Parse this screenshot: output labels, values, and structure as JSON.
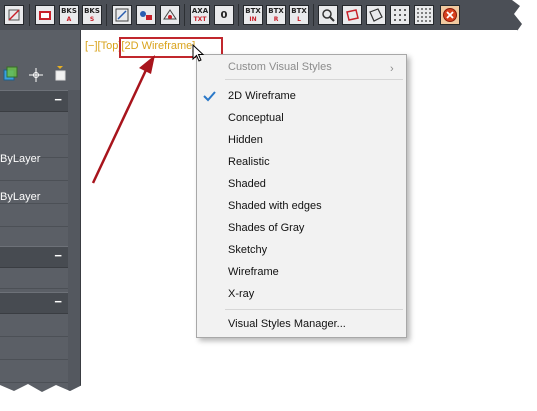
{
  "toolbar": {
    "buttons": [
      {
        "name": "tool-1",
        "label": "",
        "sub": ""
      },
      {
        "name": "tool-2",
        "label": "",
        "sub": ""
      },
      {
        "name": "bks-a",
        "label": "BKS",
        "sub": "A"
      },
      {
        "name": "bks-s",
        "label": "BKS",
        "sub": "S"
      },
      {
        "name": "tool-5",
        "label": "",
        "sub": ""
      },
      {
        "name": "tool-6",
        "label": "",
        "sub": ""
      },
      {
        "name": "tool-7",
        "label": "",
        "sub": ""
      },
      {
        "name": "tool-8",
        "label": "",
        "sub": ""
      },
      {
        "name": "axa-txt",
        "label": "AXA",
        "sub": "TXT"
      },
      {
        "name": "tool-10",
        "label": "0",
        "sub": ""
      },
      {
        "name": "btx-in",
        "label": "BTX",
        "sub": "IN"
      },
      {
        "name": "btx-r",
        "label": "BTX",
        "sub": "R"
      },
      {
        "name": "btx-l",
        "label": "BTX",
        "sub": "L"
      },
      {
        "name": "zoom",
        "label": "",
        "sub": ""
      },
      {
        "name": "tool-15",
        "label": "",
        "sub": ""
      },
      {
        "name": "tool-16",
        "label": "",
        "sub": ""
      },
      {
        "name": "tool-17",
        "label": "",
        "sub": ""
      },
      {
        "name": "tool-18",
        "label": "",
        "sub": ""
      },
      {
        "name": "close-all",
        "label": "",
        "sub": ""
      }
    ]
  },
  "left_panel": {
    "bylayer_1": "ByLayer",
    "bylayer_2": "ByLayer",
    "collapse_glyph": "−"
  },
  "viewport": {
    "label_prefix": "[−][Top]",
    "label_style": "[2D Wireframe]"
  },
  "context_menu": {
    "header": "Custom Visual Styles",
    "header_submenu_glyph": "›",
    "items": [
      {
        "label": "2D Wireframe",
        "checked": true
      },
      {
        "label": "Conceptual",
        "checked": false
      },
      {
        "label": "Hidden",
        "checked": false
      },
      {
        "label": "Realistic",
        "checked": false
      },
      {
        "label": "Shaded",
        "checked": false
      },
      {
        "label": "Shaded with edges",
        "checked": false
      },
      {
        "label": "Shades of Gray",
        "checked": false
      },
      {
        "label": "Sketchy",
        "checked": false
      },
      {
        "label": "Wireframe",
        "checked": false
      },
      {
        "label": "X-ray",
        "checked": false
      }
    ],
    "manager": "Visual Styles Manager..."
  },
  "colors": {
    "viewport_label": "#d9a31c",
    "highlight_box": "#c1272d",
    "annotation_arrow": "#a8141c",
    "checkmark": "#2a78c8",
    "toolbar": "#4b4f56",
    "panel": "#5b5f66"
  }
}
